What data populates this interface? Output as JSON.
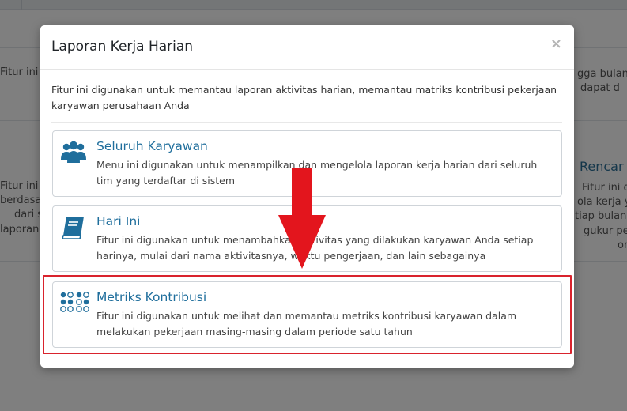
{
  "background": {
    "left_texts": [
      "Fitur ini d",
      "Fitur ini d",
      "berdasarkan",
      "dari s",
      "laporan ke"
    ],
    "right_texts": [
      "gga bulan",
      "dapat d",
      "Fitur ini digun",
      "ola kerja y",
      "tiap bulan, s",
      "gukur pen",
      "orang"
    ],
    "right_heading": "Rencar"
  },
  "modal": {
    "title": "Laporan Kerja Harian",
    "close_glyph": "×",
    "description": "Fitur ini digunakan untuk memantau laporan aktivitas harian, memantau matriks kontribusi pekerjaan karyawan perusahaan Anda",
    "cards": [
      {
        "icon": "users-icon",
        "title": "Seluruh Karyawan",
        "description": "Menu ini digunakan untuk menampilkan dan mengelola laporan kerja harian dari seluruh tim yang terdaftar di sistem"
      },
      {
        "icon": "book-icon",
        "title": "Hari Ini",
        "description": "Fitur ini digunakan untuk menambahkan aktivitas yang dilakukan karyawan Anda setiap harinya, mulai dari nama aktivitasnya, waktu pengerjaan, dan lain sebagainya"
      },
      {
        "icon": "metrics-dots-icon",
        "title": "Metriks Kontribusi",
        "description": "Fitur ini digunakan untuk melihat dan memantau metriks kontribusi karyawan dalam melakukan pekerjaan masing-masing dalam periode satu tahun"
      }
    ]
  },
  "colors": {
    "accent": "#1f6e9c",
    "highlight": "#d9232d"
  }
}
